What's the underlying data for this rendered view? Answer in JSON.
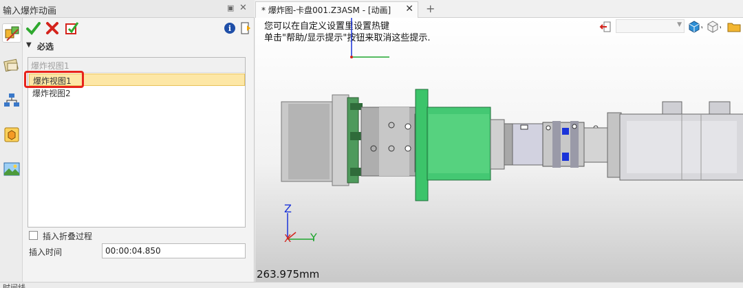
{
  "panel": {
    "title": "输入爆炸动画",
    "section_label": "必选",
    "list_header": "爆炸视图1",
    "list_items": [
      "爆炸视图1",
      "爆炸视图2"
    ],
    "selected_index": 0,
    "fold_label": "插入折叠过程",
    "time_label": "插入时间",
    "time_value": "00:00:04.850"
  },
  "document_tab": {
    "label": "* 爆炸图-卡盘001.Z3ASM - [动画]"
  },
  "viewport": {
    "hint_line1": "您可以在自定义设置里设置热键",
    "hint_line2": "单击\"帮助/显示提示\"按钮来取消这些提示.",
    "measurement": "263.975mm",
    "axis_z": "Z",
    "axis_x": "X",
    "axis_y": "Y"
  },
  "status_bar": {
    "text": "时间线"
  },
  "colors": {
    "accent_red": "#e8231b",
    "selection_yellow": "#fde7a6",
    "part_green": "#3cc46a",
    "axis_blue": "#1a33d9",
    "axis_green": "#1ea62e"
  }
}
